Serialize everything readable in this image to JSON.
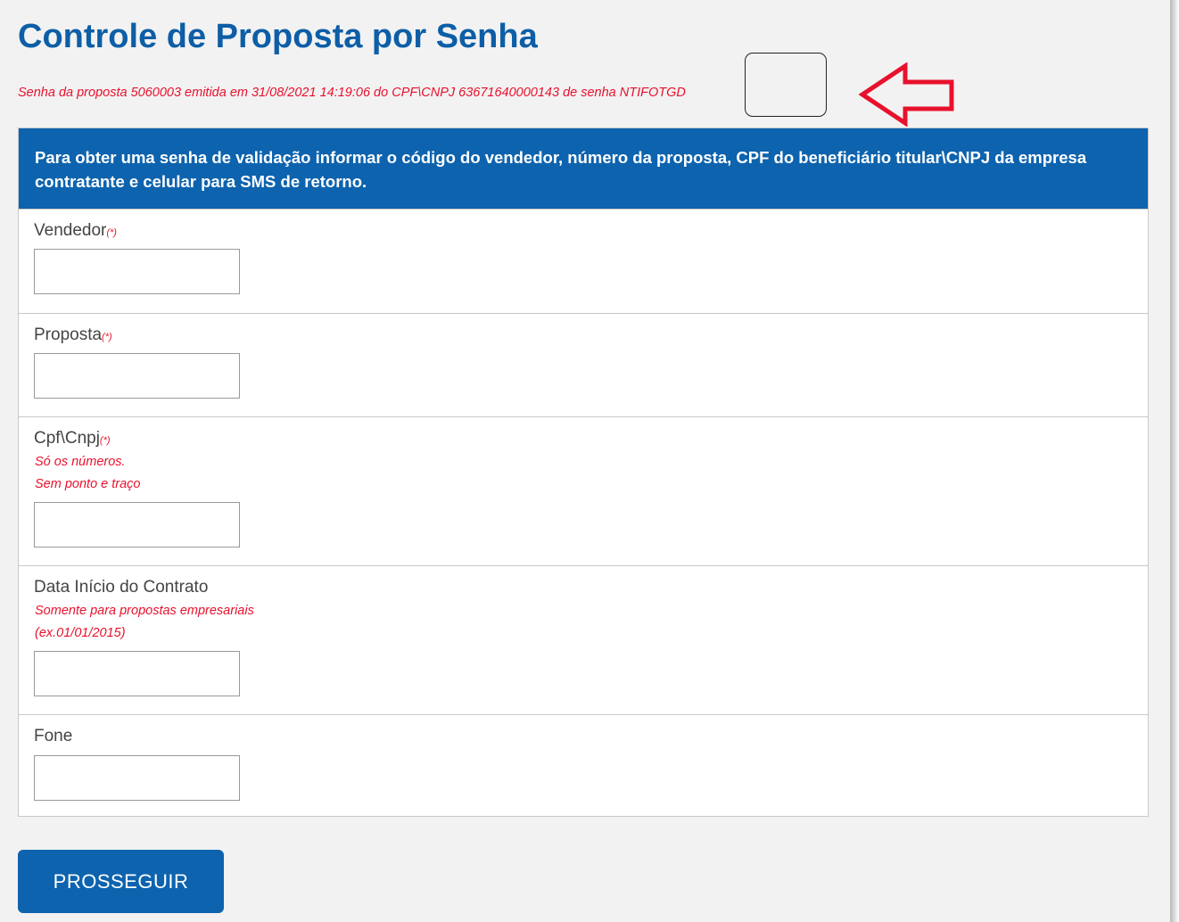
{
  "page": {
    "title": "Controle de Proposta por Senha",
    "message": {
      "prefix": "Senha da proposta 5060003 emitida em 31/08/2021 14:19:06 do CPF\\CNPJ 63671640000143 de senha ",
      "code": "NTIFOTGD"
    }
  },
  "form": {
    "header": "Para obter uma senha de validação informar o código do vendedor, número da proposta, CPF do beneficiário titular\\CNPJ da empresa contratante e celular para SMS de retorno.",
    "required_mark": "(*)",
    "fields": {
      "vendedor": {
        "label": "Vendedor",
        "value": ""
      },
      "proposta": {
        "label": "Proposta",
        "value": ""
      },
      "cpf_cnpj": {
        "label": "Cpf\\Cnpj",
        "hint1": "Só os números.",
        "hint2": "Sem ponto e traço",
        "value": ""
      },
      "data_inicio": {
        "label": "Data Início do Contrato",
        "hint1": "Somente para propostas empresariais",
        "hint2": "(ex.01/01/2015)",
        "value": ""
      },
      "fone": {
        "label": "Fone",
        "value": ""
      }
    },
    "submit_label": "PROSSEGUIR"
  },
  "annotations": {
    "arrow_icon": "left-arrow-icon",
    "arrow_color": "#e8112d",
    "highlight_color": "#222222"
  },
  "colors": {
    "title": "#0d5ea6",
    "header_bg": "#0d63ae",
    "error_red": "#e8112d"
  }
}
